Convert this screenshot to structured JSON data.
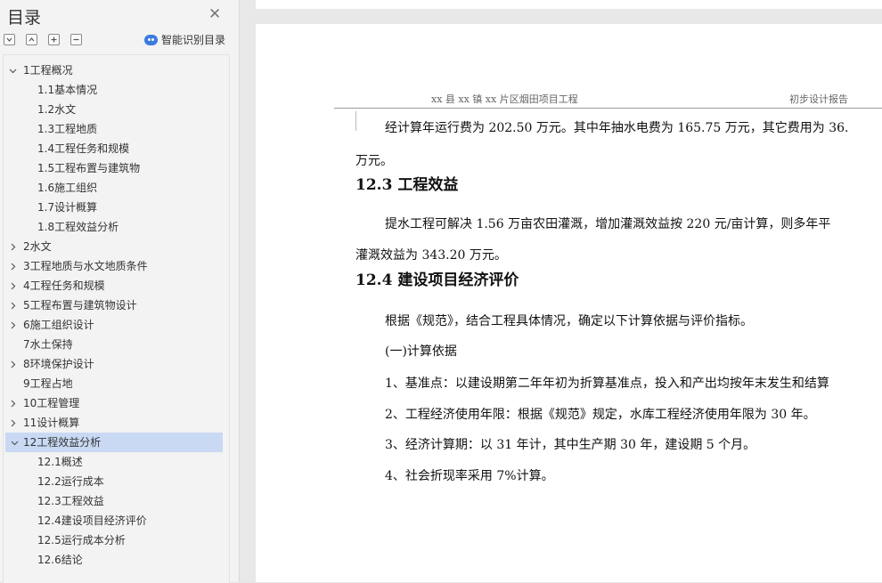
{
  "sidebar": {
    "title": "目录",
    "smart_label": "智能识别目录",
    "toc": [
      {
        "label": "1工程概况",
        "level": 1,
        "expand": "open"
      },
      {
        "label": "1.1基本情况",
        "level": 2
      },
      {
        "label": "1.2水文",
        "level": 2
      },
      {
        "label": "1.3工程地质",
        "level": 2
      },
      {
        "label": "1.4工程任务和规模",
        "level": 2
      },
      {
        "label": "1.5工程布置与建筑物",
        "level": 2
      },
      {
        "label": "1.6施工组织",
        "level": 2
      },
      {
        "label": "1.7设计概算",
        "level": 2
      },
      {
        "label": "1.8工程效益分析",
        "level": 2
      },
      {
        "label": "2水文",
        "level": 1,
        "expand": "closed"
      },
      {
        "label": "3工程地质与水文地质条件",
        "level": 1,
        "expand": "closed"
      },
      {
        "label": "4工程任务和规模",
        "level": 1,
        "expand": "closed"
      },
      {
        "label": "5工程布置与建筑物设计",
        "level": 1,
        "expand": "closed"
      },
      {
        "label": "6施工组织设计",
        "level": 1,
        "expand": "closed"
      },
      {
        "label": "7水土保持",
        "level": 1,
        "expand": "none"
      },
      {
        "label": "8环境保护设计",
        "level": 1,
        "expand": "closed"
      },
      {
        "label": "9工程占地",
        "level": 1,
        "expand": "none"
      },
      {
        "label": "10工程管理",
        "level": 1,
        "expand": "closed"
      },
      {
        "label": "11设计概算",
        "level": 1,
        "expand": "closed"
      },
      {
        "label": "12工程效益分析",
        "level": 1,
        "expand": "open",
        "active": true
      },
      {
        "label": "12.1概述",
        "level": 2
      },
      {
        "label": "12.2运行成本",
        "level": 2
      },
      {
        "label": "12.3工程效益",
        "level": 2
      },
      {
        "label": "12.4建设项目经济评价",
        "level": 2
      },
      {
        "label": "12.5运行成本分析",
        "level": 2
      },
      {
        "label": "12.6结论",
        "level": 2
      }
    ]
  },
  "document": {
    "header_left": "xx 县 xx 镇 xx 片区烟田项目工程",
    "header_right": "初步设计报告",
    "lines": {
      "l1": "经计算年运行费为 202.50 万元。其中年抽水电费为 165.75 万元，其它费用为 36.",
      "l2": "万元。",
      "h1": "12.3  工程效益",
      "l3": "提水工程可解决 1.56 万亩农田灌溉，增加灌溉效益按 220 元/亩计算，则多年平",
      "l4": "灌溉效益为 343.20 万元。",
      "h2": "12.4  建设项目经济评价",
      "l5": "根据《规范》，结合工程具体情况，确定以下计算依据与评价指标。",
      "l6": "(一)计算依据",
      "l7": "1、基准点：以建设期第二年年初为折算基准点，投入和产出均按年末发生和结算",
      "l8": "2、工程经济使用年限：根据《规范》规定，水库工程经济使用年限为 30 年。",
      "l9": "3、经济计算期：以 31 年计，其中生产期 30 年，建设期 5 个月。",
      "l10": "4、社会折现率采用 7%计算。"
    }
  },
  "icons": {
    "close": "close-icon",
    "collapse_all": "collapse-all-icon",
    "expand_up": "expand-up-icon",
    "add": "add-heading-icon",
    "remove": "remove-heading-icon",
    "smart": "smart-toc-icon"
  },
  "colors": {
    "active_row": "#c9d9f4",
    "accent": "#3a7be0"
  }
}
